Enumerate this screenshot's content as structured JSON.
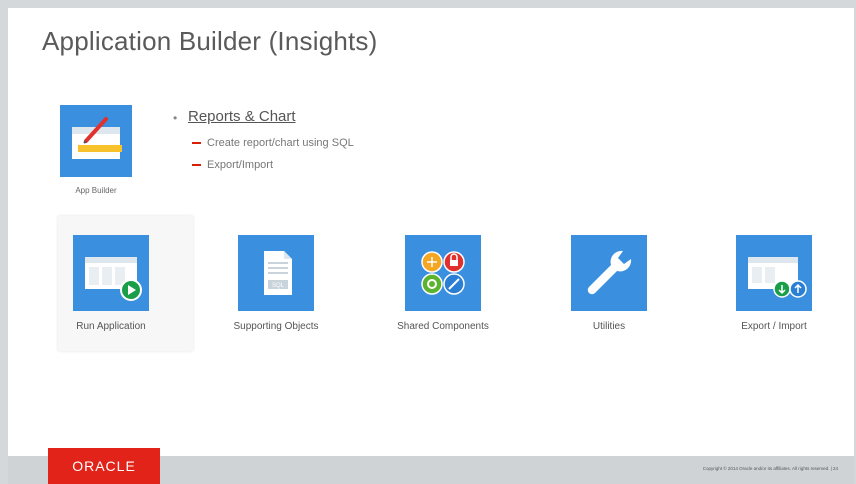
{
  "slide": {
    "title": "Application Builder (Insights)"
  },
  "app_builder": {
    "label": "App Builder"
  },
  "bullets": {
    "main": "Reports & Chart",
    "subs": [
      "Create report/chart using SQL",
      "Export/Import"
    ]
  },
  "tiles": [
    {
      "label": "Run Application",
      "icon": "run-application-icon"
    },
    {
      "label": "Supporting Objects",
      "icon": "supporting-objects-icon"
    },
    {
      "label": "Shared Components",
      "icon": "shared-components-icon"
    },
    {
      "label": "Utilities",
      "icon": "wrench-icon"
    },
    {
      "label": "Export / Import",
      "icon": "export-import-icon"
    }
  ],
  "footer": {
    "logo_text": "ORACLE",
    "copyright": "Copyright © 2014 Oracle and/or its affiliates. All rights reserved. | 24"
  },
  "colors": {
    "tile_blue": "#3a8fdf",
    "oracle_red": "#e2231a",
    "dash_red": "#d81e05",
    "play_green": "#1a9e49",
    "icon_orange": "#f5a623",
    "icon_red": "#e0312e",
    "icon_green": "#5cb32e",
    "icon_blue": "#2a7fd4"
  }
}
